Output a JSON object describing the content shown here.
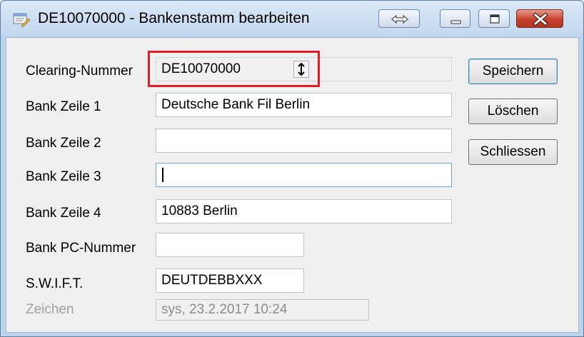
{
  "window": {
    "title": "DE10070000 - Bankenstamm bearbeiten",
    "icons": {
      "app": "bank-edit-icon",
      "swap": "swap-arrows-icon",
      "minimize": "minimize-icon",
      "maximize": "maximize-icon",
      "close": "close-icon"
    }
  },
  "form": {
    "clearing": {
      "label": "Clearing-Nummer",
      "value": "DE10070000",
      "spinner_icon": "up-down-arrow-icon"
    },
    "bank1": {
      "label": "Bank Zeile 1",
      "value": "Deutsche Bank Fil Berlin"
    },
    "bank2": {
      "label": "Bank Zeile 2",
      "value": ""
    },
    "bank3": {
      "label": "Bank Zeile 3",
      "value": ""
    },
    "bank4": {
      "label": "Bank Zeile 4",
      "value": "10883 Berlin"
    },
    "pc": {
      "label": "Bank PC-Nummer",
      "value": ""
    },
    "swift": {
      "label": "S.W.I.F.T.",
      "value": "DEUTDEBBXXX"
    },
    "zeichen": {
      "label": "Zeichen",
      "value": "sys,  23.2.2017  10:24"
    }
  },
  "buttons": {
    "save": "Speichern",
    "delete": "Löschen",
    "close": "Schliessen"
  },
  "colors": {
    "highlight": "#e21c22",
    "title_bar": "#c2d7ef",
    "close_button": "#c4402b"
  }
}
